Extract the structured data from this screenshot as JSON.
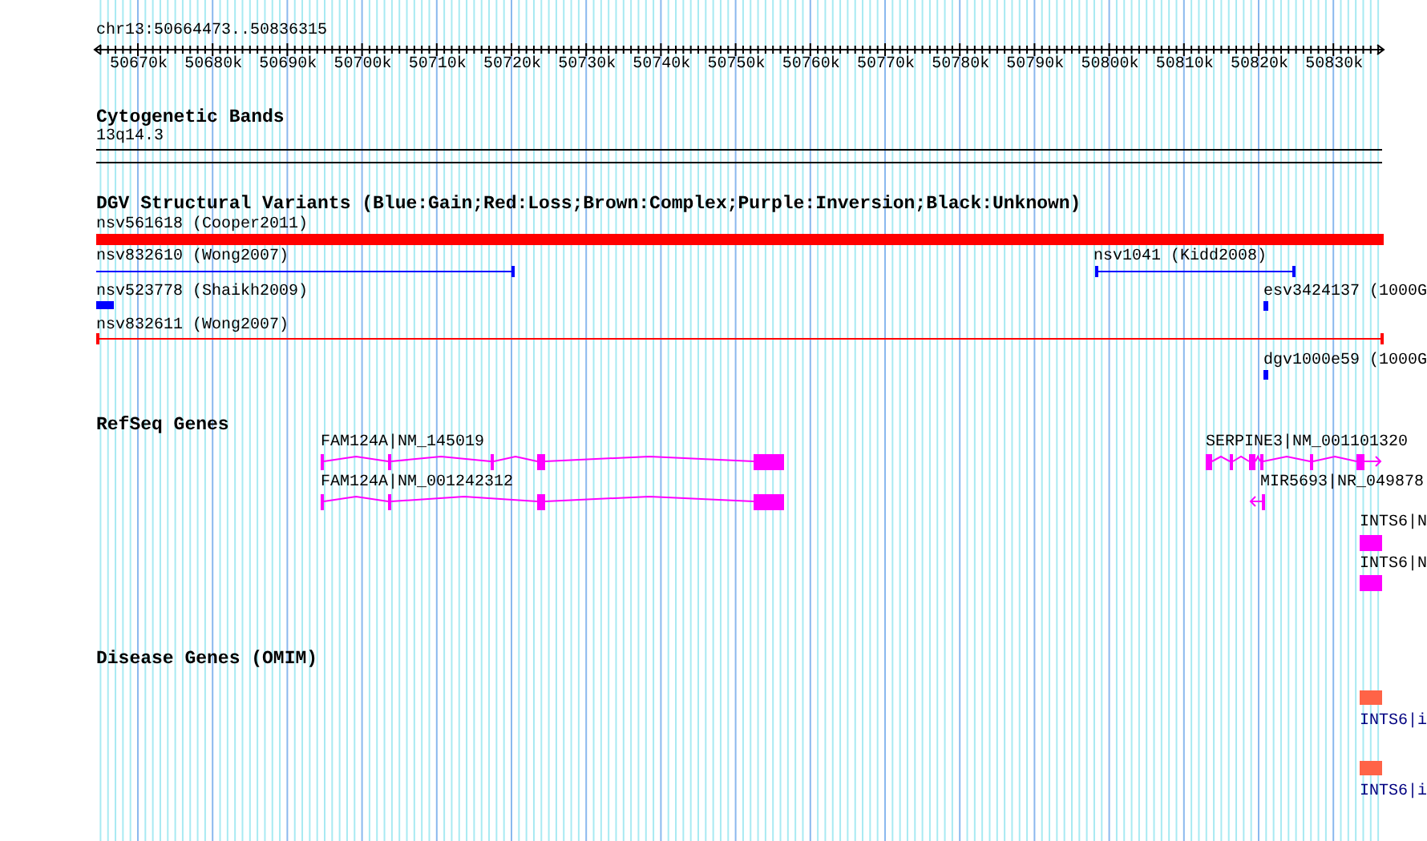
{
  "position": "chr13:50664473..50836315",
  "ruler": {
    "tick_labels": [
      "50670k",
      "50680k",
      "50690k",
      "50700k",
      "50710k",
      "50720k",
      "50730k",
      "50740k",
      "50750k",
      "50760k",
      "50770k",
      "50780k",
      "50790k",
      "50800k",
      "50810k",
      "50820k",
      "50830k"
    ]
  },
  "tracks": [
    {
      "kind": "cytoband",
      "title": "Cytogenetic Bands",
      "band": "13q14.3"
    },
    {
      "kind": "variants",
      "title": "DGV Structural Variants (Blue:Gain;Red:Loss;Brown:Complex;Purple:Inversion;Black:Unknown)",
      "features": [
        {
          "label": "nsv561618 (Cooper2011)",
          "color": "#ff0000"
        },
        {
          "label": "nsv832610 (Wong2007)",
          "color": "#0000ff"
        },
        {
          "label": "nsv1041 (Kidd2008)",
          "color": "#0000ff"
        },
        {
          "label": "nsv523778 (Shaikh2009)",
          "color": "#0000ff"
        },
        {
          "label": "esv3424137 (1000G",
          "color": "#0000ff"
        },
        {
          "label": "nsv832611 (Wong2007)",
          "color": "#ff0000"
        },
        {
          "label": "dgv1000e59 (1000G",
          "color": "#0000ff"
        }
      ]
    },
    {
      "kind": "genes",
      "title": "RefSeq Genes",
      "features": [
        {
          "label": "FAM124A|NM_145019"
        },
        {
          "label": "FAM124A|NM_001242312"
        },
        {
          "label": "SERPINE3|NM_001101320"
        },
        {
          "label": "MIR5693|NR_049878"
        },
        {
          "label": "INTS6|N"
        },
        {
          "label": "INTS6|N"
        }
      ]
    },
    {
      "kind": "omim",
      "title": "Disease Genes (OMIM)",
      "features": [
        {
          "label": "INTS6|i"
        },
        {
          "label": "INTS6|i"
        }
      ]
    }
  ]
}
